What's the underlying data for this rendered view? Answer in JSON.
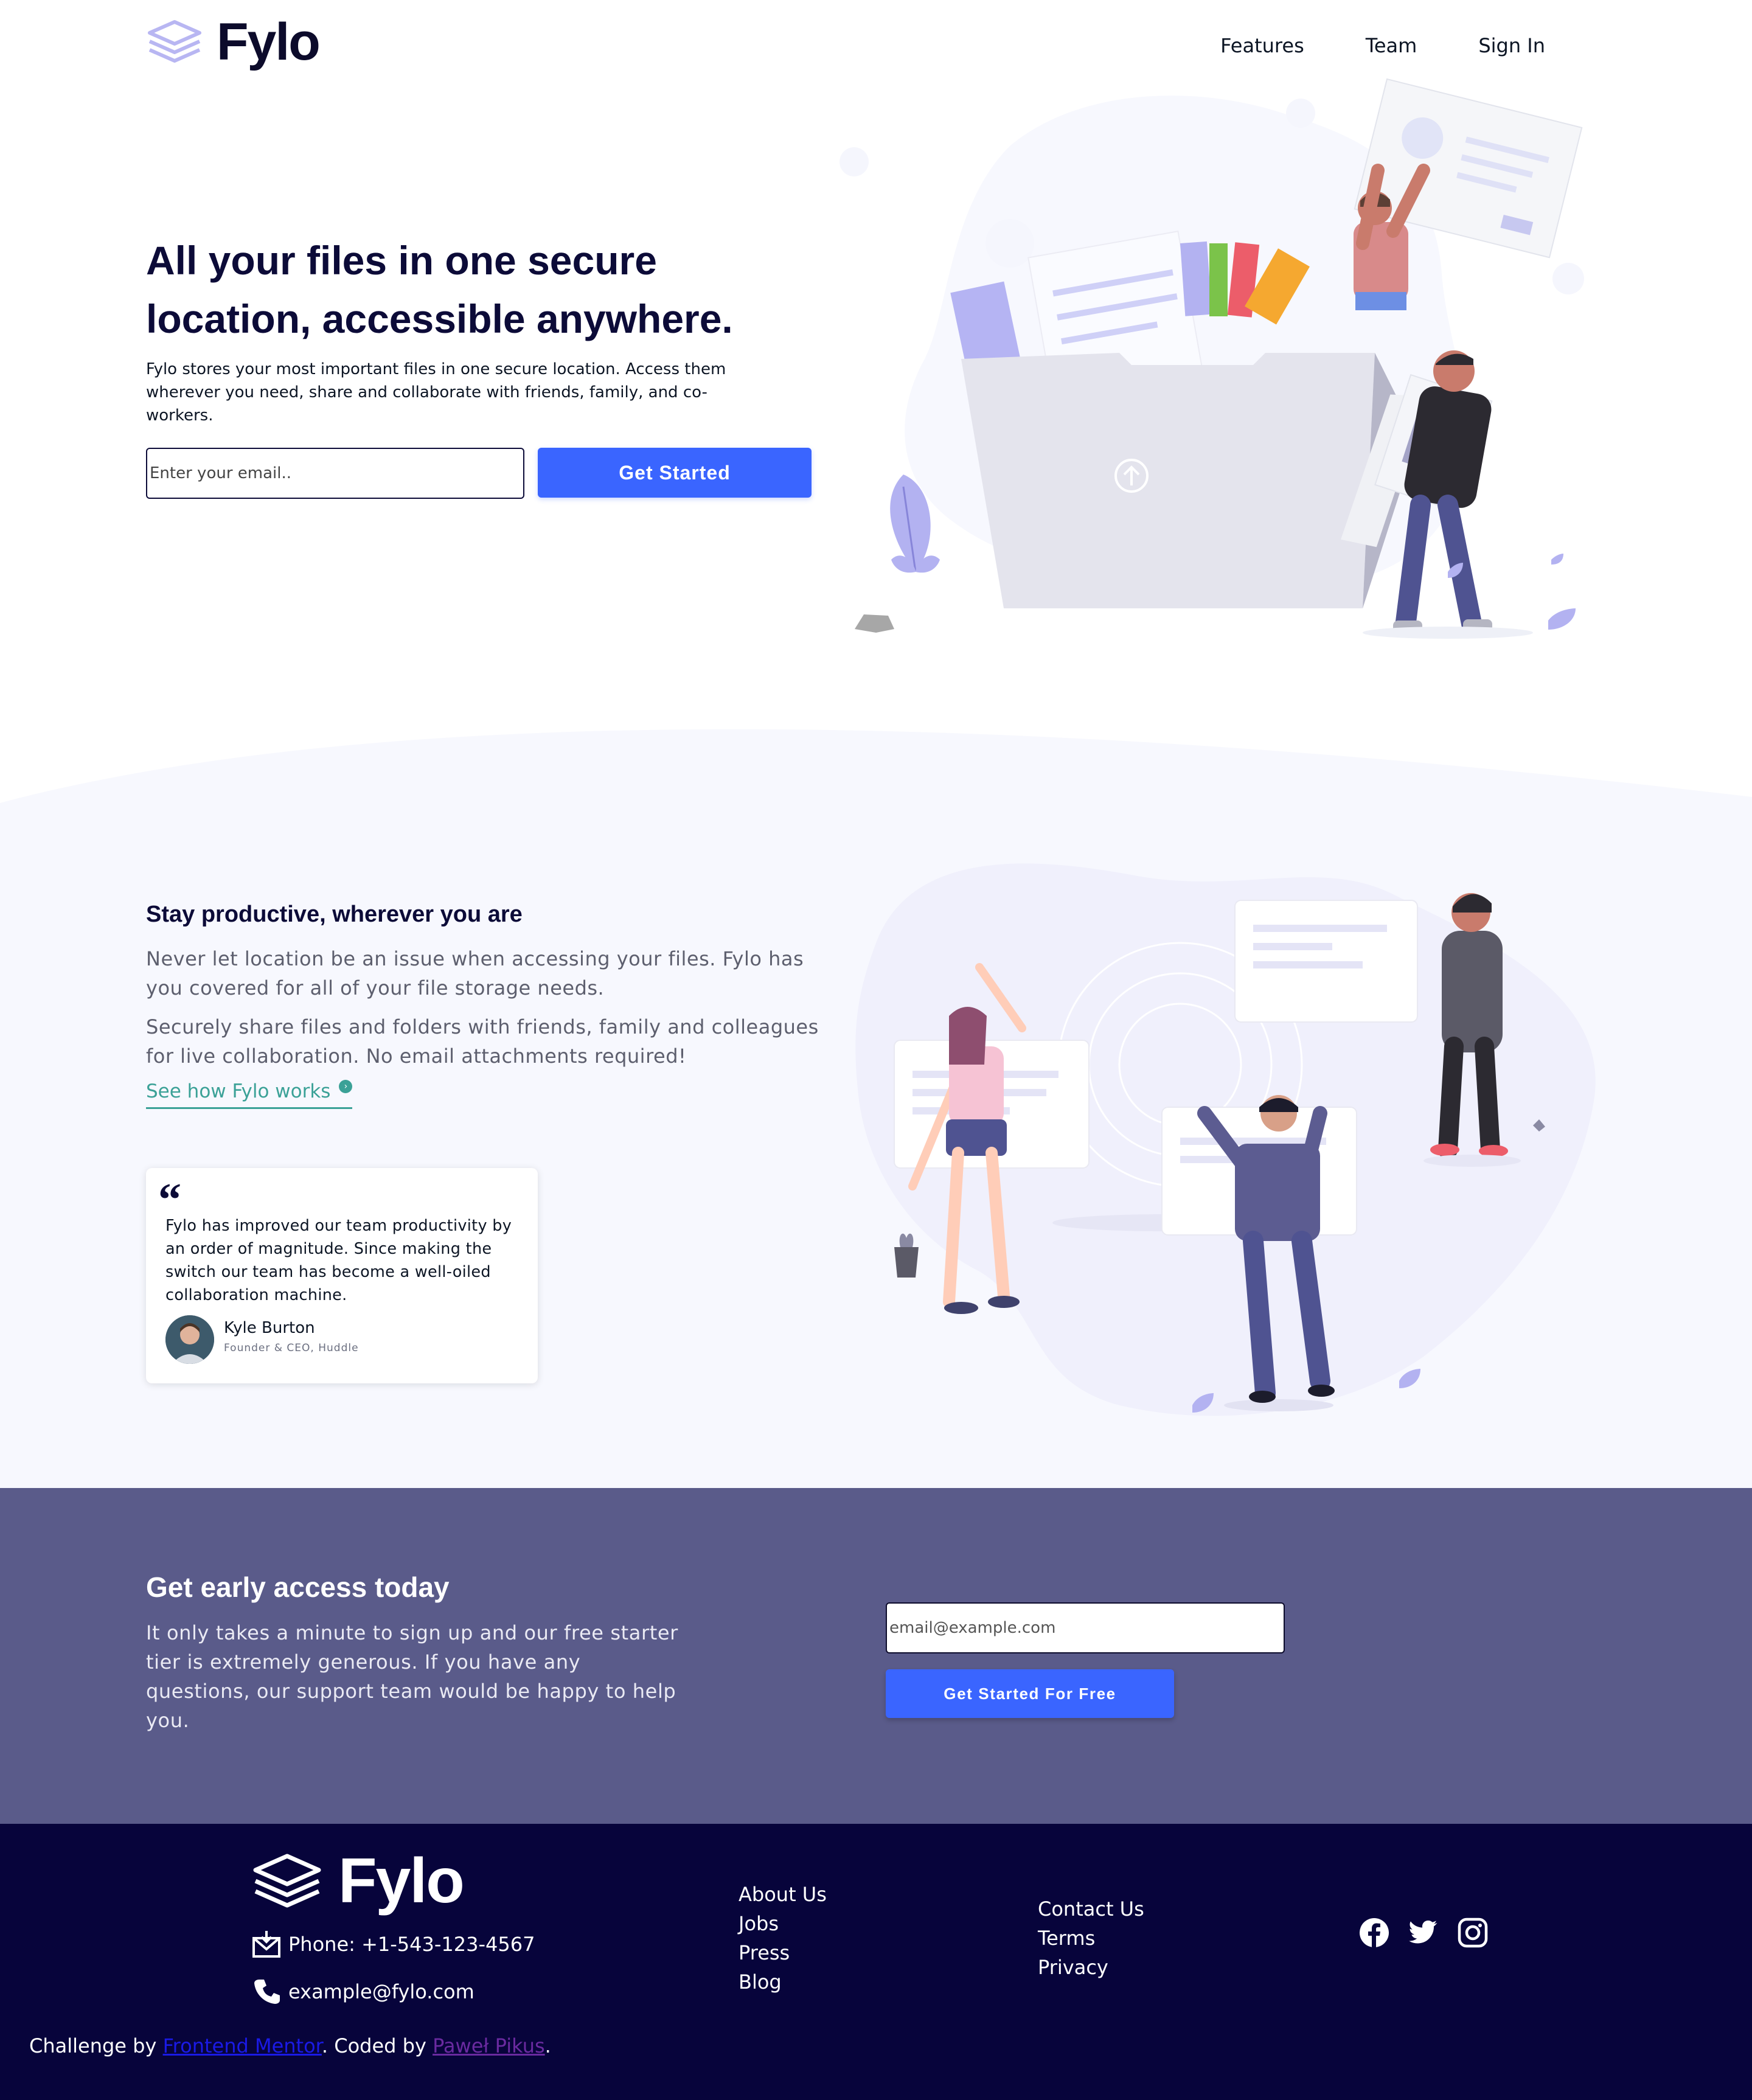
{
  "header": {
    "brand": "Fylo",
    "nav": [
      "Features",
      "Team",
      "Sign In"
    ]
  },
  "hero": {
    "title_line1": "All your files in one secure",
    "title_line2": "location, accessible anywhere.",
    "description": "Fylo stores your most important files in one secure location. Access them wherever you need, share and collaborate with friends, family, and co-workers.",
    "email_placeholder": "Enter your email..",
    "cta": "Get Started"
  },
  "productive": {
    "title": "Stay productive, wherever you are",
    "p1": "Never let location be an issue when accessing your files. Fylo has you covered for all of your file storage needs.",
    "p2": "Securely share files and folders with friends, family and colleagues for live collaboration. No email attachments required!",
    "link": "See how Fylo works",
    "testimonial": {
      "quote_mark": "“",
      "text": "Fylo has improved our team productivity by an order of magnitude. Since making the switch our team has become a well-oiled collaboration machine.",
      "name": "Kyle Burton",
      "role": "Founder & CEO, Huddle"
    }
  },
  "early_access": {
    "title": "Get early access today",
    "text": "It only takes a minute to sign up and our free starter tier is extremely generous. If you have any questions, our support team would be happy to help you.",
    "email_placeholder": "email@example.com",
    "cta": "Get Started For Free"
  },
  "footer": {
    "brand": "Fylo",
    "phone": "Phone: +1-543-123-4567",
    "email": "example@fylo.com",
    "col1": [
      "About Us",
      "Jobs",
      "Press",
      "Blog"
    ],
    "col2": [
      "Contact Us",
      "Terms",
      "Privacy"
    ],
    "social": [
      "facebook-icon",
      "twitter-icon",
      "instagram-icon"
    ],
    "credit_prefix": "Challenge by ",
    "credit_fm": "Frontend Mentor",
    "credit_mid": ". Coded by ",
    "credit_author": "Paweł Pikus",
    "credit_suffix": "."
  },
  "colors": {
    "accent_blue": "#3a65ff",
    "navy": "#0c0b38",
    "teal_link": "#3ba197",
    "early_bg": "#5a5b8a",
    "footer_bg": "#07043b",
    "section_bg": "#f7f8fe"
  }
}
